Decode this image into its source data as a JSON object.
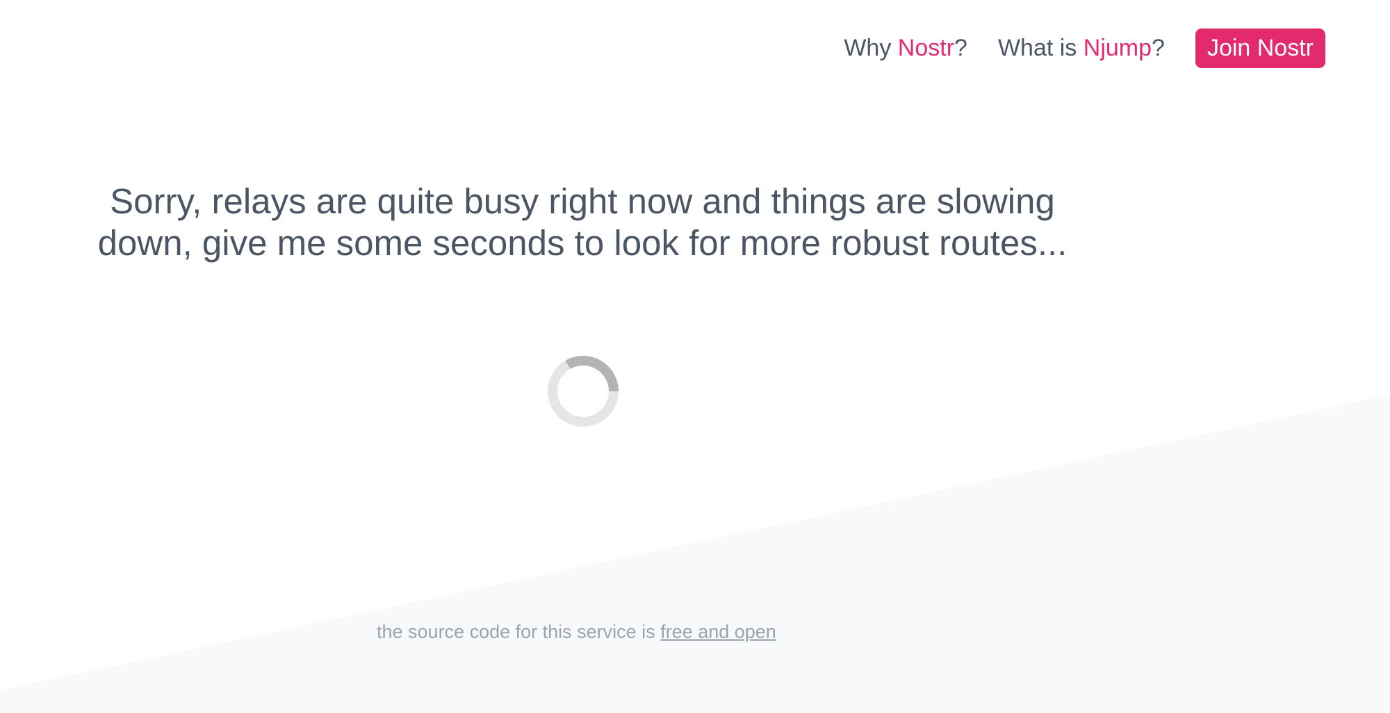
{
  "nav": {
    "why_prefix": "Why ",
    "why_accent": "Nostr",
    "why_suffix": "?",
    "what_prefix": "What is ",
    "what_accent": "Njump",
    "what_suffix": "?",
    "join_label": "Join Nostr"
  },
  "main": {
    "message": "Sorry, relays are quite busy right now and things are slowing down, give me some seconds to look for more robust routes..."
  },
  "footer": {
    "text": "the source code for this service is ",
    "link_label": "free and open"
  },
  "colors": {
    "accent": "#e32a6d",
    "text": "#4b5563",
    "muted": "#9ca3af",
    "background_wedge": "#f8f9fb",
    "spinner_track": "#e5e5e5",
    "spinner_arc": "#b3b3b3"
  },
  "icons": {
    "spinner": "loading-spinner-icon"
  }
}
